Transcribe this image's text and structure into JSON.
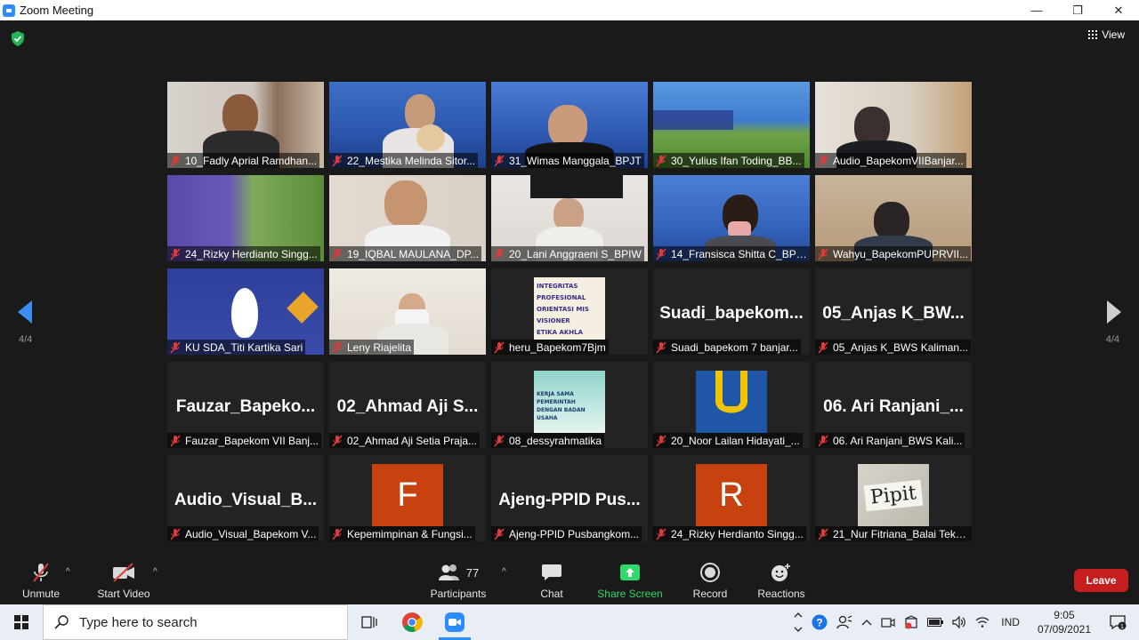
{
  "window": {
    "title": "Zoom Meeting",
    "controls": [
      "—",
      "❐",
      "✕"
    ]
  },
  "view": {
    "label": "View"
  },
  "pagination": {
    "left": "4/4",
    "right": "4/4"
  },
  "tiles": [
    {
      "name": "10_Fadly Aprial Ramdhan..."
    },
    {
      "name": "22_Mestika Melinda Sitor..."
    },
    {
      "name": "31_Wimas Manggala_BPJT"
    },
    {
      "name": "30_Yulius Ifan Toding_BB..."
    },
    {
      "name": "Audio_BapekomVIIBanjar..."
    },
    {
      "name": "24_Rizky Herdianto Singg..."
    },
    {
      "name": "19_IQBAL MAULANA_DP..."
    },
    {
      "name": "20_Lani Anggraeni S_BPIW"
    },
    {
      "name": "14_Fransisca Shitta C_BPJ..."
    },
    {
      "name": "Wahyu_BapekomPUPRVII..."
    },
    {
      "name": "KU SDA_Titi Kartika Sari"
    },
    {
      "name": "Leny Riajelita"
    },
    {
      "name": "heru_Bapekom7Bjm"
    },
    {
      "name": "Suadi_bapekom 7 banjar...",
      "big": "Suadi_bapekom..."
    },
    {
      "name": "05_Anjas K_BWS Kaliman...",
      "big": "05_Anjas K_BW..."
    },
    {
      "name": "Fauzar_Bapekom VII Banj...",
      "big": "Fauzar_Bapeko..."
    },
    {
      "name": "02_Ahmad Aji Setia Praja...",
      "big": "02_Ahmad Aji S..."
    },
    {
      "name": "08_dessyrahmatika"
    },
    {
      "name": "20_Noor Lailan Hidayati_..."
    },
    {
      "name": "06. Ari Ranjani_BWS Kali...",
      "big": "06. Ari Ranjani_..."
    },
    {
      "name": "Audio_Visual_Bapekom V...",
      "big": "Audio_Visual_B..."
    },
    {
      "name": "Kepemimpinan & Fungsi...",
      "letter": "F"
    },
    {
      "name": "Ajeng-PPID Pusbangkom...",
      "big": "Ajeng-PPID  Pus..."
    },
    {
      "name": "24_Rizky Herdianto Singg...",
      "letter": "R"
    },
    {
      "name": "21_Nur Fitriana_Balai Teknik ...",
      "pipit": "Pipit"
    }
  ],
  "thumbs": {
    "integritas": [
      "INTEGRITAS",
      "PROFESIONAL",
      "ORIENTASI MIS",
      "VISIONER",
      "ETIKA AKHLA"
    ],
    "kerja": [
      "KERJA SAMA PEMERINTAH",
      "DENGAN BADAN USAHA"
    ]
  },
  "toolbar": {
    "unmute": "Unmute",
    "start_video": "Start Video",
    "participants": "Participants",
    "participant_count": "77",
    "chat": "Chat",
    "share_screen": "Share Screen",
    "record": "Record",
    "reactions": "Reactions",
    "leave": "Leave"
  },
  "taskbar": {
    "search_placeholder": "Type here to search",
    "lang": "IND",
    "time": "9:05",
    "date": "07/09/2021"
  },
  "colors": {
    "accent": "#2d8cff",
    "share": "#2fd86a",
    "leave": "#c41e1e",
    "mic_off": "#e03a3a",
    "avatar_bg": "#c8420f"
  }
}
